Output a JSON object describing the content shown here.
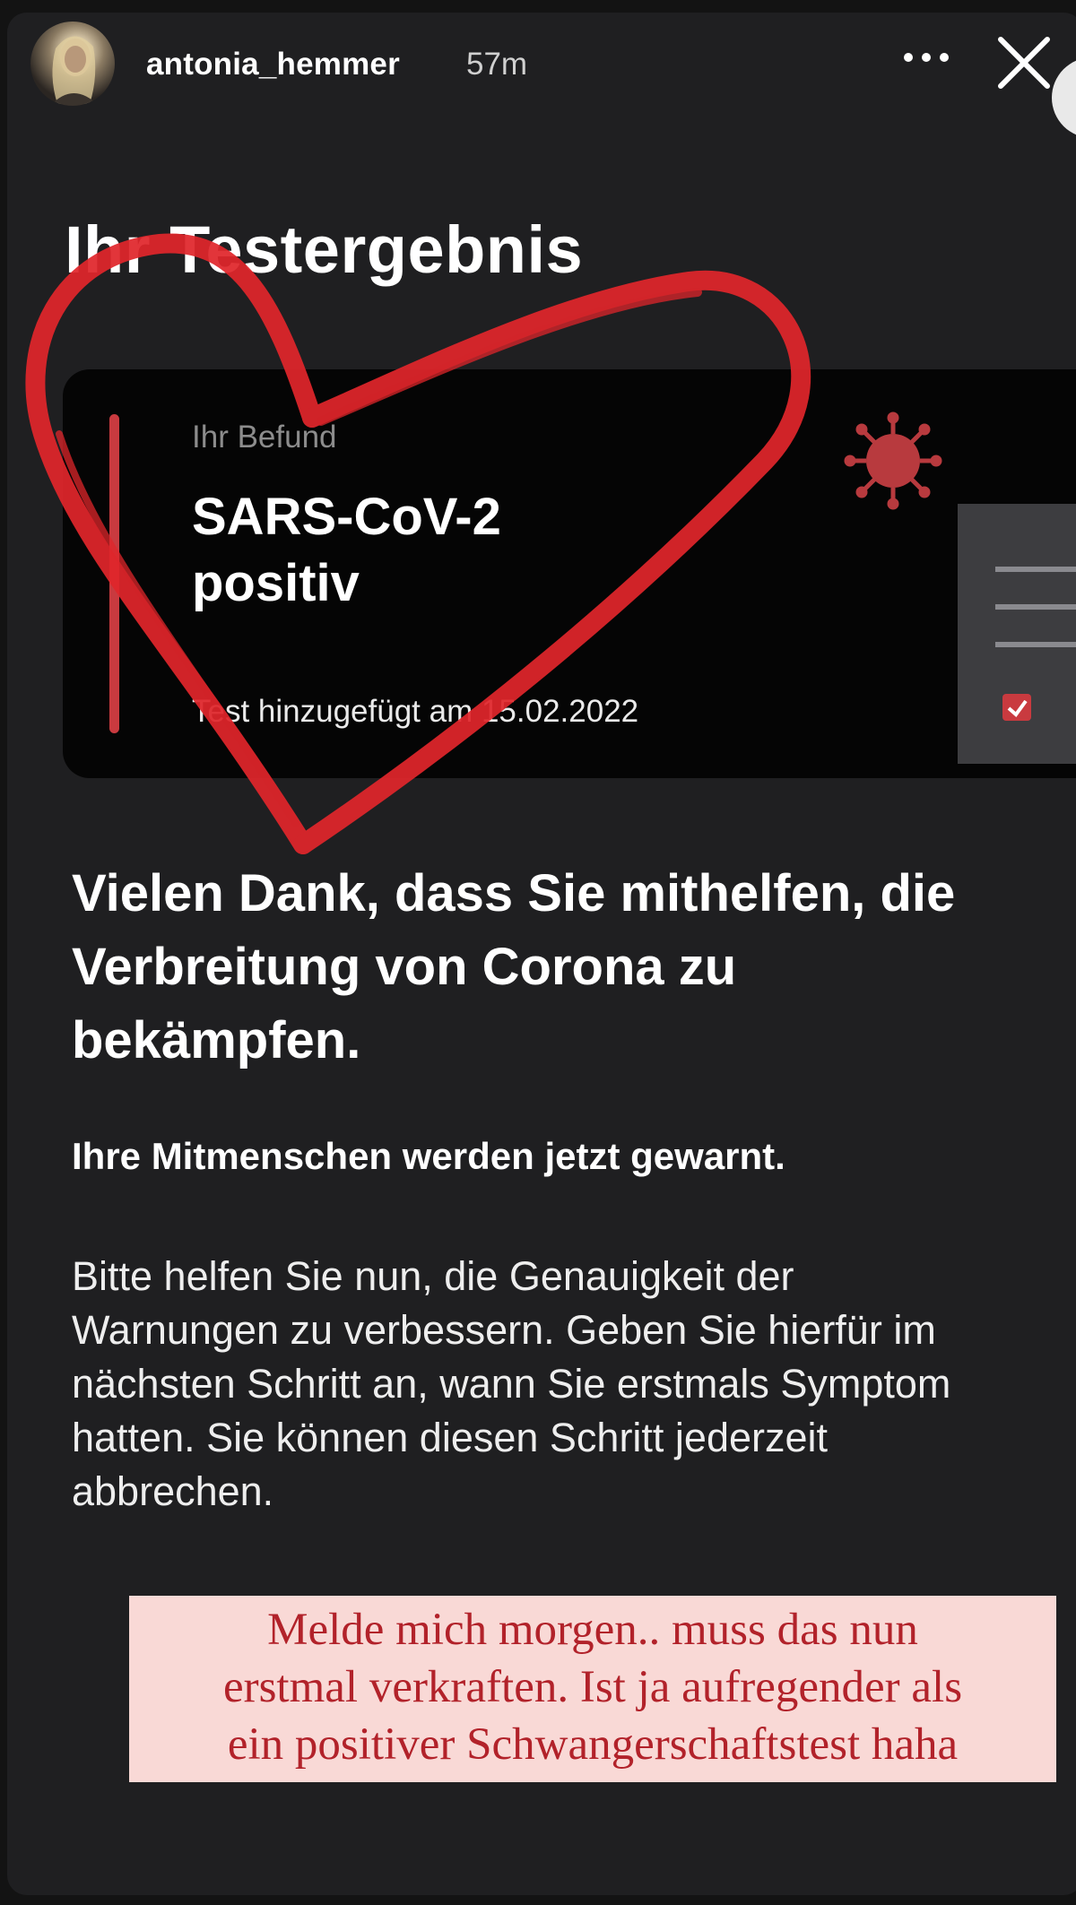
{
  "story": {
    "username": "antonia_hemmer",
    "time_ago": "57m",
    "more_icon": "more-horizontal-icon",
    "close_icon": "close-icon"
  },
  "app": {
    "heading": "Ihr Testergebnis",
    "card": {
      "label": "Ihr Befund",
      "result_line1": "SARS-CoV-2",
      "result_line2": "positiv",
      "date_text": "Test hinzugefügt am 15.02.2022",
      "accent_color": "#c93a3f",
      "illustration": "virus-document-icon"
    },
    "thanks_lines": [
      "Vielen Dank, dass Sie mithelfen, die",
      "Verbreitung von Corona zu",
      "bekämpfen."
    ],
    "warned": "Ihre Mitmenschen werden jetzt gewarnt.",
    "help_lines": [
      "Bitte helfen Sie nun, die Genauigkeit der",
      "Warnungen zu verbessern. Geben Sie hierfür im",
      "nächsten Schritt an, wann Sie erstmals Symptom",
      "hatten. Sie können diesen Schritt jederzeit",
      "abbrechen."
    ]
  },
  "overlay": {
    "sticker": "heart-drawing",
    "sticker_color": "#e0262b",
    "caption_lines": [
      "Melde mich morgen.. muss das nun",
      "erstmal verkraften. Ist ja aufregender als",
      "ein positiver Schwangerschaftstest haha"
    ],
    "caption_bg": "#f9d9d6",
    "caption_color": "#b2222a"
  }
}
